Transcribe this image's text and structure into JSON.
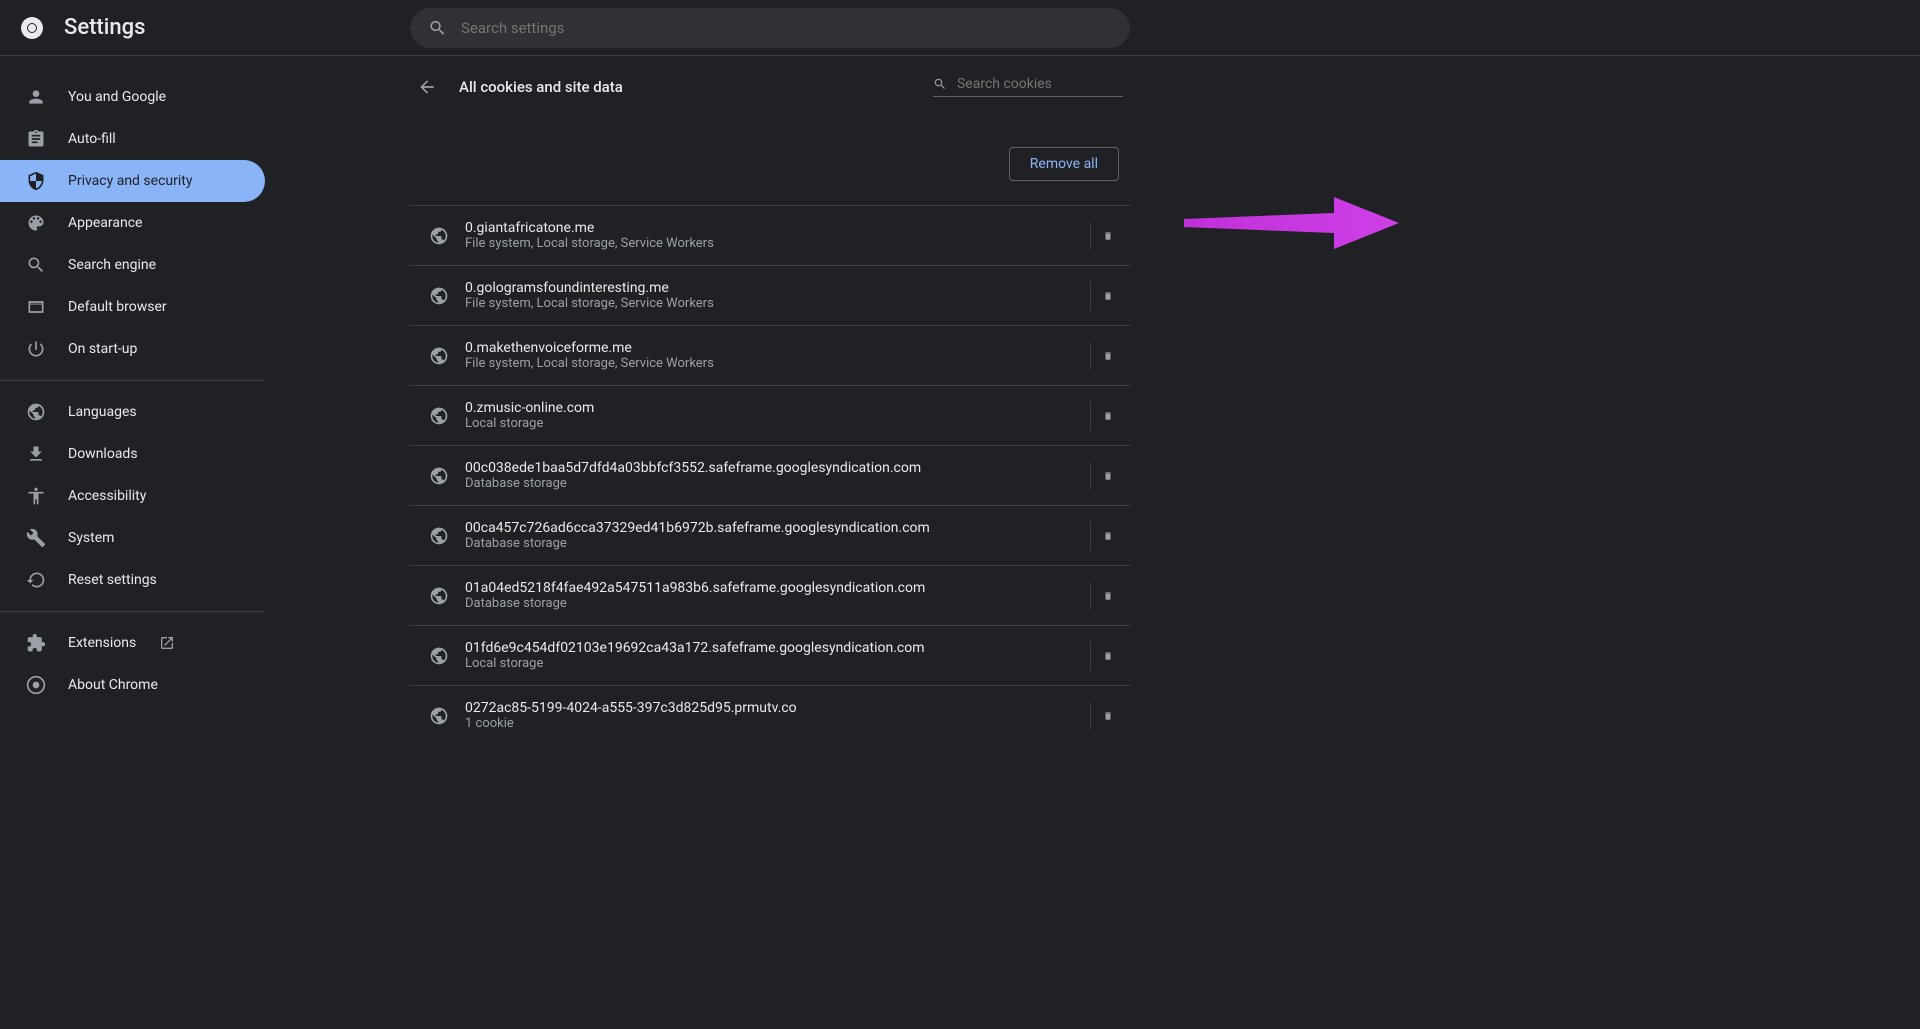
{
  "header": {
    "title": "Settings",
    "search_placeholder": "Search settings"
  },
  "sidebar": {
    "items": [
      {
        "key": "you-and-google",
        "label": "You and Google",
        "icon": "person"
      },
      {
        "key": "autofill",
        "label": "Auto-fill",
        "icon": "clipboard"
      },
      {
        "key": "privacy-security",
        "label": "Privacy and security",
        "icon": "shield",
        "active": true
      },
      {
        "key": "appearance",
        "label": "Appearance",
        "icon": "palette"
      },
      {
        "key": "search-engine",
        "label": "Search engine",
        "icon": "search"
      },
      {
        "key": "default-browser",
        "label": "Default browser",
        "icon": "browser"
      },
      {
        "key": "on-startup",
        "label": "On start-up",
        "icon": "power"
      }
    ],
    "items2": [
      {
        "key": "languages",
        "label": "Languages",
        "icon": "globe"
      },
      {
        "key": "downloads",
        "label": "Downloads",
        "icon": "download"
      },
      {
        "key": "accessibility",
        "label": "Accessibility",
        "icon": "accessibility"
      },
      {
        "key": "system",
        "label": "System",
        "icon": "wrench"
      },
      {
        "key": "reset-settings",
        "label": "Reset settings",
        "icon": "restore"
      }
    ],
    "items3": [
      {
        "key": "extensions",
        "label": "Extensions",
        "icon": "puzzle",
        "external": true
      },
      {
        "key": "about-chrome",
        "label": "About Chrome",
        "icon": "chrome"
      }
    ]
  },
  "content": {
    "title": "All cookies and site data",
    "cookie_search_placeholder": "Search cookies",
    "remove_all_label": "Remove all",
    "sites": [
      {
        "domain": "0.giantafricatone.me",
        "detail": "File system, Local storage, Service Workers"
      },
      {
        "domain": "0.gologramsfoundinteresting.me",
        "detail": "File system, Local storage, Service Workers"
      },
      {
        "domain": "0.makethenvoiceforme.me",
        "detail": "File system, Local storage, Service Workers"
      },
      {
        "domain": "0.zmusic-online.com",
        "detail": "Local storage"
      },
      {
        "domain": "00c038ede1baa5d7dfd4a03bbfcf3552.safeframe.googlesyndication.com",
        "detail": "Database storage"
      },
      {
        "domain": "00ca457c726ad6cca37329ed41b6972b.safeframe.googlesyndication.com",
        "detail": "Database storage"
      },
      {
        "domain": "01a04ed5218f4fae492a547511a983b6.safeframe.googlesyndication.com",
        "detail": "Database storage"
      },
      {
        "domain": "01fd6e9c454df02103e19692ca43a172.safeframe.googlesyndication.com",
        "detail": "Local storage"
      },
      {
        "domain": "0272ac85-5199-4024-a555-397c3d825d95.prmutv.co",
        "detail": "1 cookie"
      }
    ]
  }
}
